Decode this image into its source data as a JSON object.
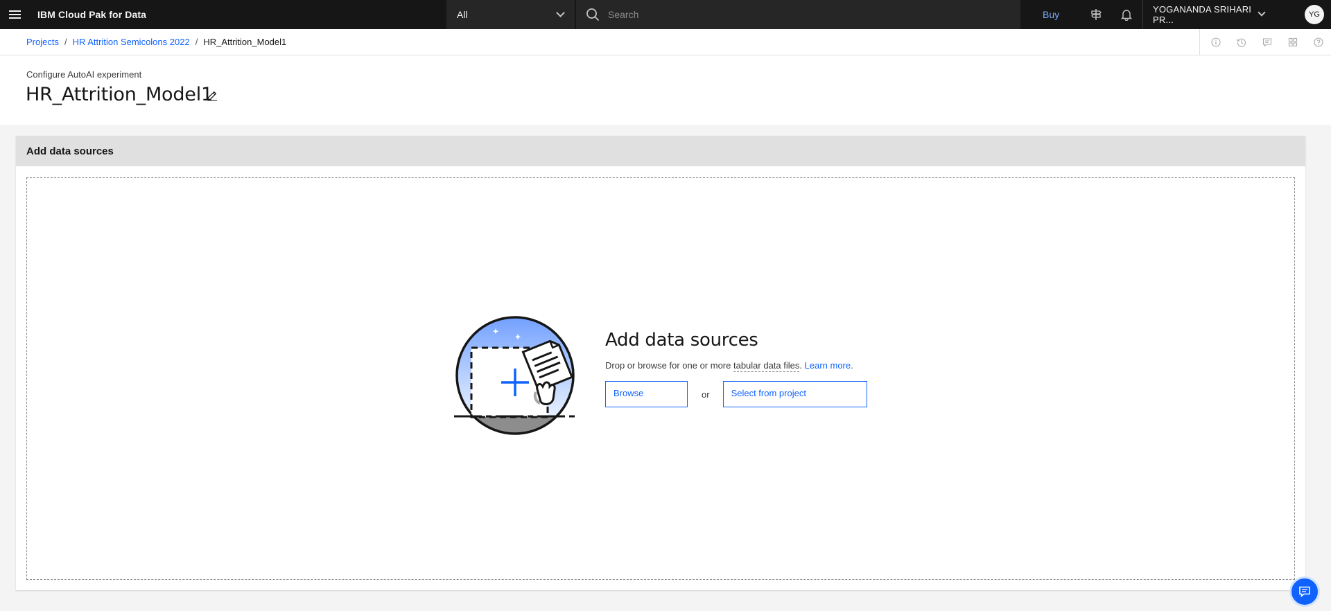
{
  "header": {
    "brand": "IBM Cloud Pak for Data",
    "scope_value": "All",
    "search_placeholder": "Search",
    "buy_label": "Buy",
    "account_name": "YOGANANDA SRIHARI PR...",
    "avatar_initials": "YG"
  },
  "breadcrumb": {
    "items": [
      "Projects",
      "HR Attrition Semicolons 2022"
    ],
    "current": "HR_Attrition_Model1",
    "separator": "/"
  },
  "page": {
    "subtitle": "Configure AutoAI experiment",
    "title": "HR_Attrition_Model1"
  },
  "panel": {
    "heading": "Add data sources"
  },
  "empty_state": {
    "title": "Add data sources",
    "description_prefix": "Drop or browse for one or more",
    "description_term": "tabular data files",
    "description_period": ".",
    "learn_more": "Learn more",
    "learn_more_period": ".",
    "browse_label": "Browse",
    "or_label": "or",
    "select_label": "Select from project"
  },
  "colors": {
    "accent": "#0f62fe",
    "header_bg": "#161616",
    "buy_link": "#78a9ff"
  },
  "icons": [
    "menu-icon",
    "search-icon",
    "signpost-icon",
    "notification-icon",
    "info-icon",
    "history-icon",
    "comment-icon",
    "grid-icon",
    "help-icon",
    "edit-icon",
    "chat-icon"
  ]
}
